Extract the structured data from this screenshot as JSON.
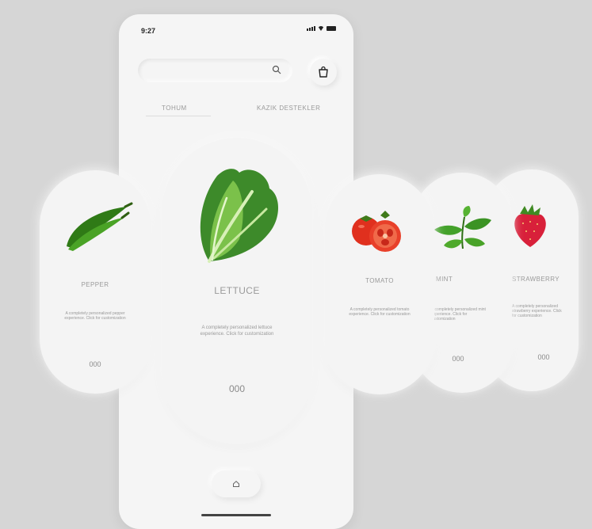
{
  "status_bar": {
    "time": "9:27"
  },
  "search": {
    "placeholder": ""
  },
  "tabs": [
    {
      "label": "TOHUM",
      "active": true
    },
    {
      "label": "KAZIK DESTEKLER",
      "active": false
    }
  ],
  "products": [
    {
      "name": "PEPPER",
      "description": "A completely personalized pepper experience. Click for customization",
      "price": "000"
    },
    {
      "name": "LETTUCE",
      "description": "A completely personalized lettuce experience. Click for customization",
      "price": "000"
    },
    {
      "name": "TOMATO",
      "description": "A completely personalized tomato experience. Click for customization",
      "price": ""
    },
    {
      "name": "MINT",
      "description": "A completely personalized mint experience. Click for customization",
      "price": "000"
    },
    {
      "name": "STRAWBERRY",
      "description": "A completely personalized strawberry experience. Click for customization",
      "price": "000"
    }
  ],
  "icons": {
    "search": "search-icon",
    "cart": "shopping-bag-icon",
    "home": "home-icon"
  },
  "colors": {
    "background": "#d6d6d6",
    "surface": "#f5f5f5",
    "pepper_green": "#3e8a1e",
    "tomato_red": "#e0301e",
    "strawberry_red": "#d8203a"
  }
}
